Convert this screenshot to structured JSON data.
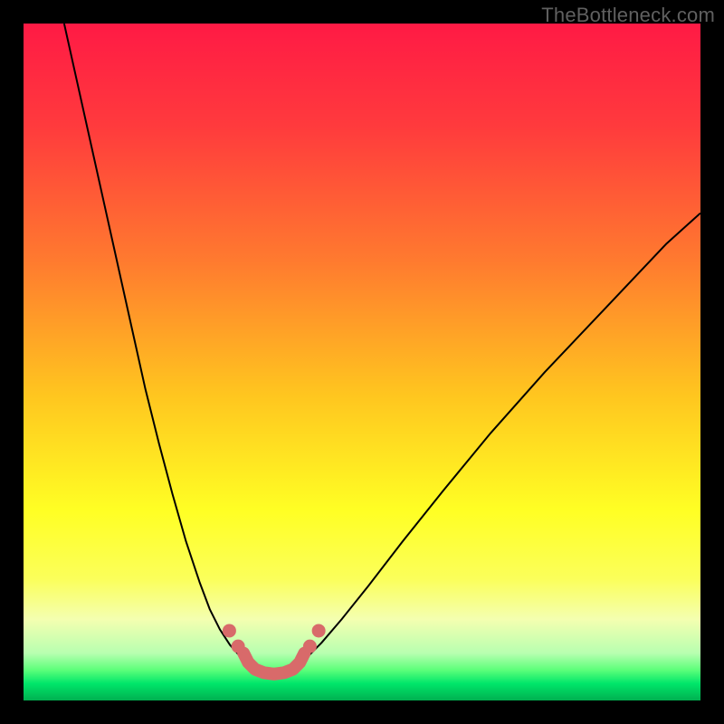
{
  "watermark": "TheBottleneck.com",
  "chart_data": {
    "type": "line",
    "title": "",
    "xlabel": "",
    "ylabel": "",
    "xlim": [
      0,
      100
    ],
    "ylim": [
      0,
      100
    ],
    "gradient_stops": [
      {
        "offset": 0.0,
        "color": "#ff1a45"
      },
      {
        "offset": 0.15,
        "color": "#ff3a3d"
      },
      {
        "offset": 0.35,
        "color": "#ff7a2f"
      },
      {
        "offset": 0.55,
        "color": "#ffc61f"
      },
      {
        "offset": 0.72,
        "color": "#ffff24"
      },
      {
        "offset": 0.82,
        "color": "#fbff5a"
      },
      {
        "offset": 0.88,
        "color": "#f4ffb0"
      },
      {
        "offset": 0.93,
        "color": "#b8ffb0"
      },
      {
        "offset": 0.955,
        "color": "#5cff7a"
      },
      {
        "offset": 0.975,
        "color": "#00e66a"
      },
      {
        "offset": 1.0,
        "color": "#00b050"
      }
    ],
    "series": [
      {
        "name": "left_curve",
        "color": "#000000",
        "width": 2,
        "x": [
          6,
          8,
          10,
          12,
          14,
          16,
          18,
          20,
          22,
          24,
          26,
          27.5,
          29,
          30.5,
          32,
          33.5
        ],
        "y": [
          100,
          91,
          82,
          73,
          64,
          55,
          46,
          38,
          30.5,
          23.5,
          17.5,
          13.5,
          10.5,
          8.2,
          6.5,
          5.4
        ]
      },
      {
        "name": "right_curve",
        "color": "#000000",
        "width": 2,
        "x": [
          40.5,
          42,
          44,
          47,
          51,
          56,
          62,
          69,
          77,
          86,
          95,
          100
        ],
        "y": [
          5.4,
          6.5,
          8.5,
          12,
          17,
          23.5,
          31,
          39.5,
          48.5,
          58,
          67.5,
          72
        ]
      },
      {
        "name": "valley_floor_segment",
        "color": "#d86a6a",
        "width": 14,
        "linecap": "round",
        "x": [
          32.5,
          33.2,
          34.2,
          35.5,
          37,
          38.5,
          39.8,
          40.8,
          41.5
        ],
        "y": [
          7.0,
          5.6,
          4.6,
          4.1,
          3.9,
          4.1,
          4.6,
          5.6,
          7.0
        ]
      },
      {
        "name": "left_bead_upper",
        "type": "marker",
        "color": "#d86a6a",
        "size": 15,
        "x": [
          30.4
        ],
        "y": [
          10.3
        ]
      },
      {
        "name": "left_bead_lower",
        "type": "marker",
        "color": "#d86a6a",
        "size": 15,
        "x": [
          31.7
        ],
        "y": [
          8.0
        ]
      },
      {
        "name": "right_bead_upper",
        "type": "marker",
        "color": "#d86a6a",
        "size": 15,
        "x": [
          43.6
        ],
        "y": [
          10.3
        ]
      },
      {
        "name": "right_bead_lower",
        "type": "marker",
        "color": "#d86a6a",
        "size": 15,
        "x": [
          42.3
        ],
        "y": [
          8.0
        ]
      }
    ]
  }
}
